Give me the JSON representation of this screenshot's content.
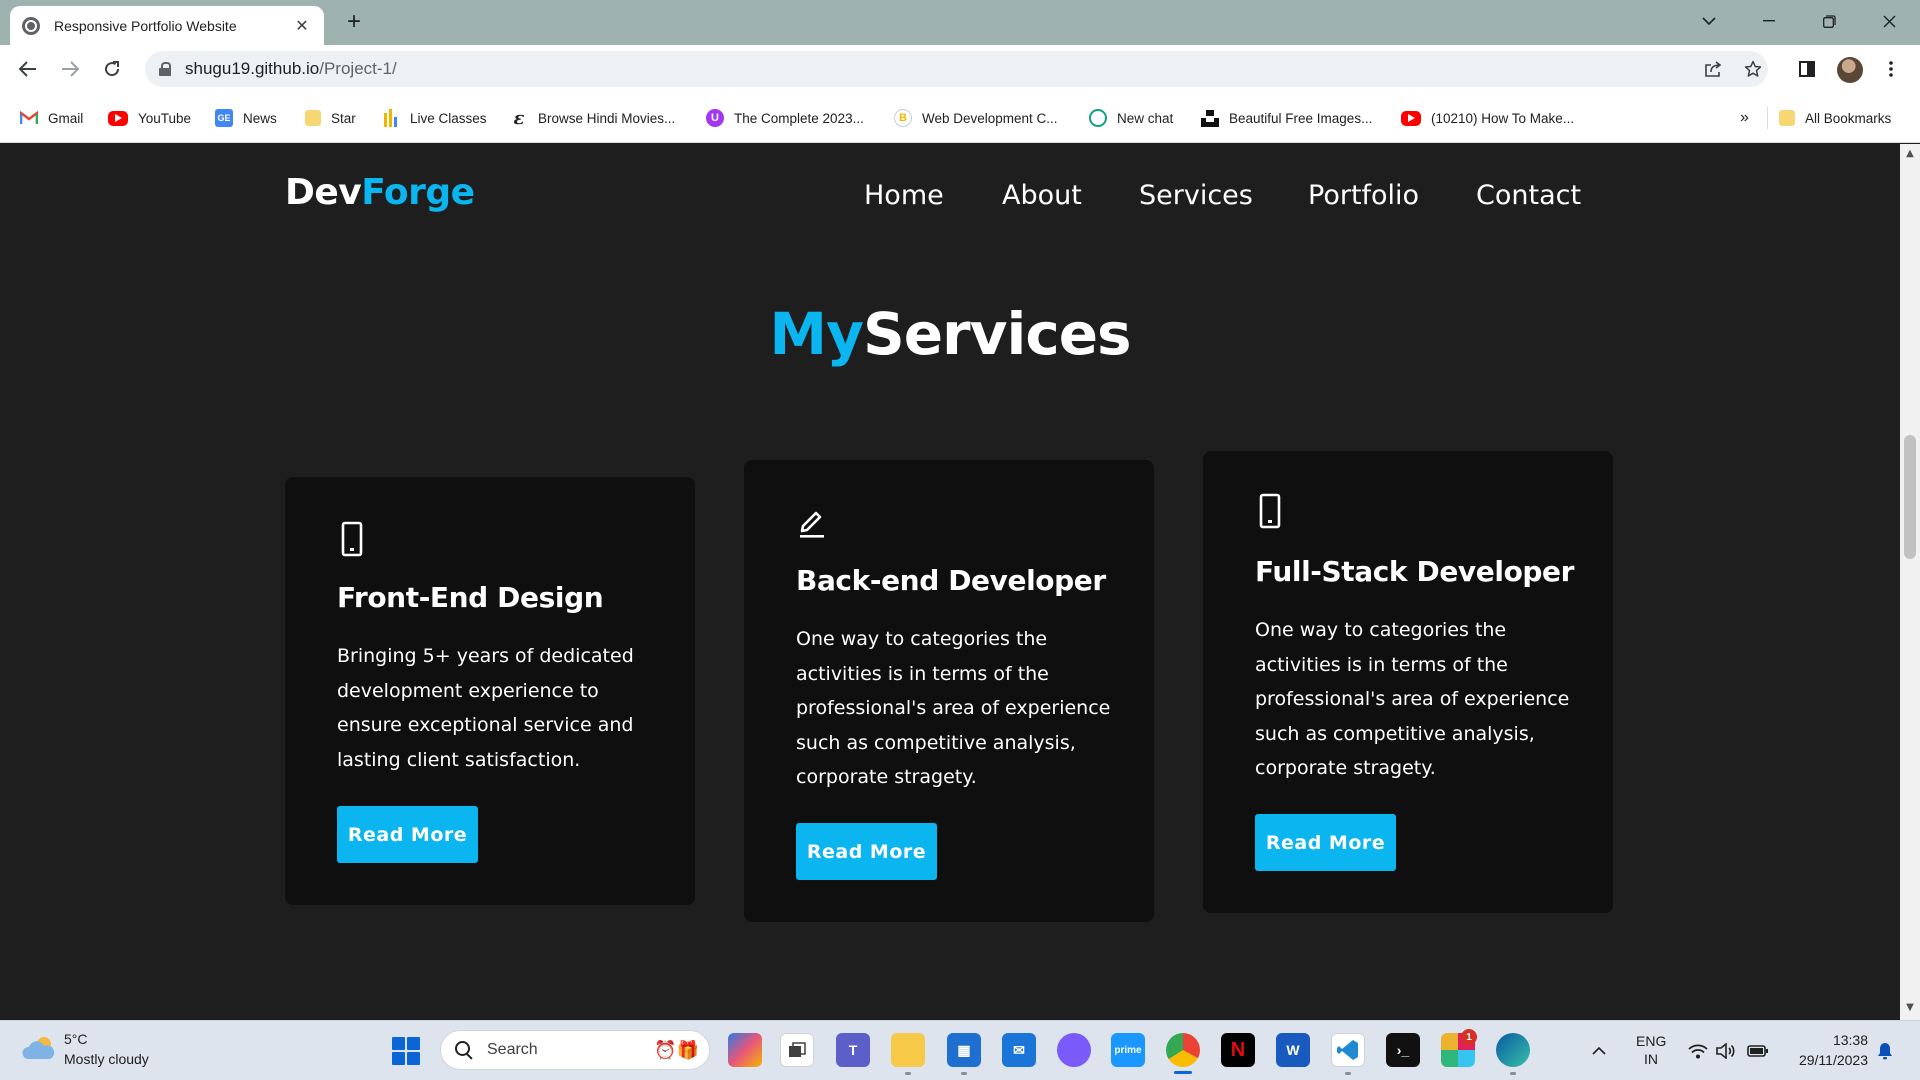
{
  "browser": {
    "tab_title": "Responsive Portfolio Website",
    "tab_close": "✕",
    "new_tab": "+",
    "url_host": "shugu19.github.io",
    "url_path": "/Project-1/",
    "bookmarks": [
      {
        "label": "Gmail",
        "icon": "gmail-icon",
        "color": "#ea4335"
      },
      {
        "label": "YouTube",
        "icon": "youtube-icon",
        "color": "#ff0000"
      },
      {
        "label": "News",
        "icon": "google-news-icon",
        "color": "#4285f4"
      },
      {
        "label": "Star",
        "icon": "folder-icon",
        "color": "#f7d774"
      },
      {
        "label": "Live Classes",
        "icon": "live-classes-icon",
        "color": "#f4b400"
      },
      {
        "label": "Browse Hindi Movies...",
        "icon": "movies-site-icon",
        "color": "#202124"
      },
      {
        "label": "The Complete 2023...",
        "icon": "udemy-icon",
        "color": "#a435f0"
      },
      {
        "label": "Web Development C...",
        "icon": "course-site-icon",
        "color": "#f4b400"
      },
      {
        "label": "New chat",
        "icon": "chatgpt-icon",
        "color": "#10a37f"
      },
      {
        "label": "Beautiful Free Images...",
        "icon": "unsplash-icon",
        "color": "#111111"
      },
      {
        "label": "(10210) How To Make...",
        "icon": "youtube-icon",
        "color": "#ff0000"
      }
    ],
    "bookmarks_overflow": "»",
    "all_bookmarks": "All Bookmarks"
  },
  "site": {
    "logo_part1": "Dev",
    "logo_part2": "Forge",
    "nav": [
      "Home",
      "About",
      "Services",
      "Portfolio",
      "Contact"
    ],
    "section_title_part1": "My",
    "section_title_part2": "Services",
    "accent_color": "#0ab5f0",
    "cards": [
      {
        "icon": "mobile-phone-icon",
        "title": "Front-End Design",
        "description": "Bringing 5+ years of dedicated development experience to ensure exceptional service and lasting client satisfaction.",
        "button": "Read More"
      },
      {
        "icon": "pencil-edit-icon",
        "title": "Back-end Developer",
        "description": "One way to categories the activities is in terms of the professional's area of experience such as competitive analysis, corporate stragety.",
        "button": "Read More"
      },
      {
        "icon": "mobile-phone-icon",
        "title": "Full-Stack Developer",
        "description": "One way to categories the activities is in terms of the professional's area of experience such as competitive analysis, corporate stragety.",
        "button": "Read More"
      }
    ]
  },
  "taskbar": {
    "weather_temp": "5°C",
    "weather_desc": "Mostly cloudy",
    "search_placeholder": "Search",
    "lang_line1": "ENG",
    "lang_line2": "IN",
    "time": "13:38",
    "date": "29/11/2023",
    "slack_badge": "1"
  }
}
